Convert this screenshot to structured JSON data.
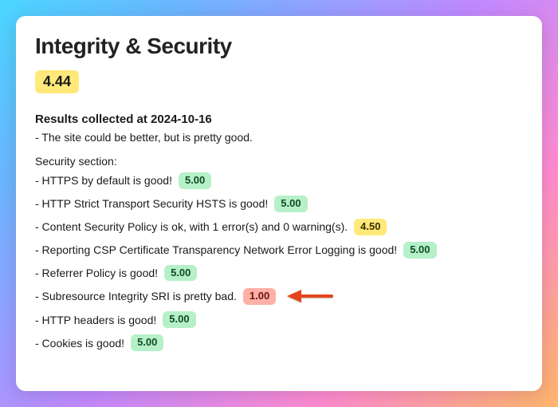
{
  "title": "Integrity & Security",
  "overall_score": "4.44",
  "overall_score_class": "badge-yellow",
  "collected_label": "Results collected at 2024-10-16",
  "summary_line": "- The site could be better, but is pretty good.",
  "section_label": "Security section:",
  "badge_colors": {
    "green": "#b6f0c8",
    "yellow": "#ffe97a",
    "red": "#ffb0a6"
  },
  "results": [
    {
      "text": "- HTTPS by default is good!",
      "score": "5.00",
      "score_class": "badge-green",
      "highlight": false
    },
    {
      "text": "- HTTP Strict Transport Security HSTS is good!",
      "score": "5.00",
      "score_class": "badge-green",
      "highlight": false
    },
    {
      "text": "- Content Security Policy is ok, with 1 error(s) and 0 warning(s).",
      "score": "4.50",
      "score_class": "badge-yellow",
      "highlight": false
    },
    {
      "text": "- Reporting CSP Certificate Transparency Network Error Logging is good!",
      "score": "5.00",
      "score_class": "badge-green",
      "highlight": false
    },
    {
      "text": "- Referrer Policy is good!",
      "score": "5.00",
      "score_class": "badge-green",
      "highlight": false
    },
    {
      "text": "- Subresource Integrity SRI is pretty bad.",
      "score": "1.00",
      "score_class": "badge-red",
      "highlight": true
    },
    {
      "text": "- HTTP headers is good!",
      "score": "5.00",
      "score_class": "badge-green",
      "highlight": false
    },
    {
      "text": "- Cookies is good!",
      "score": "5.00",
      "score_class": "badge-green",
      "highlight": false
    }
  ]
}
